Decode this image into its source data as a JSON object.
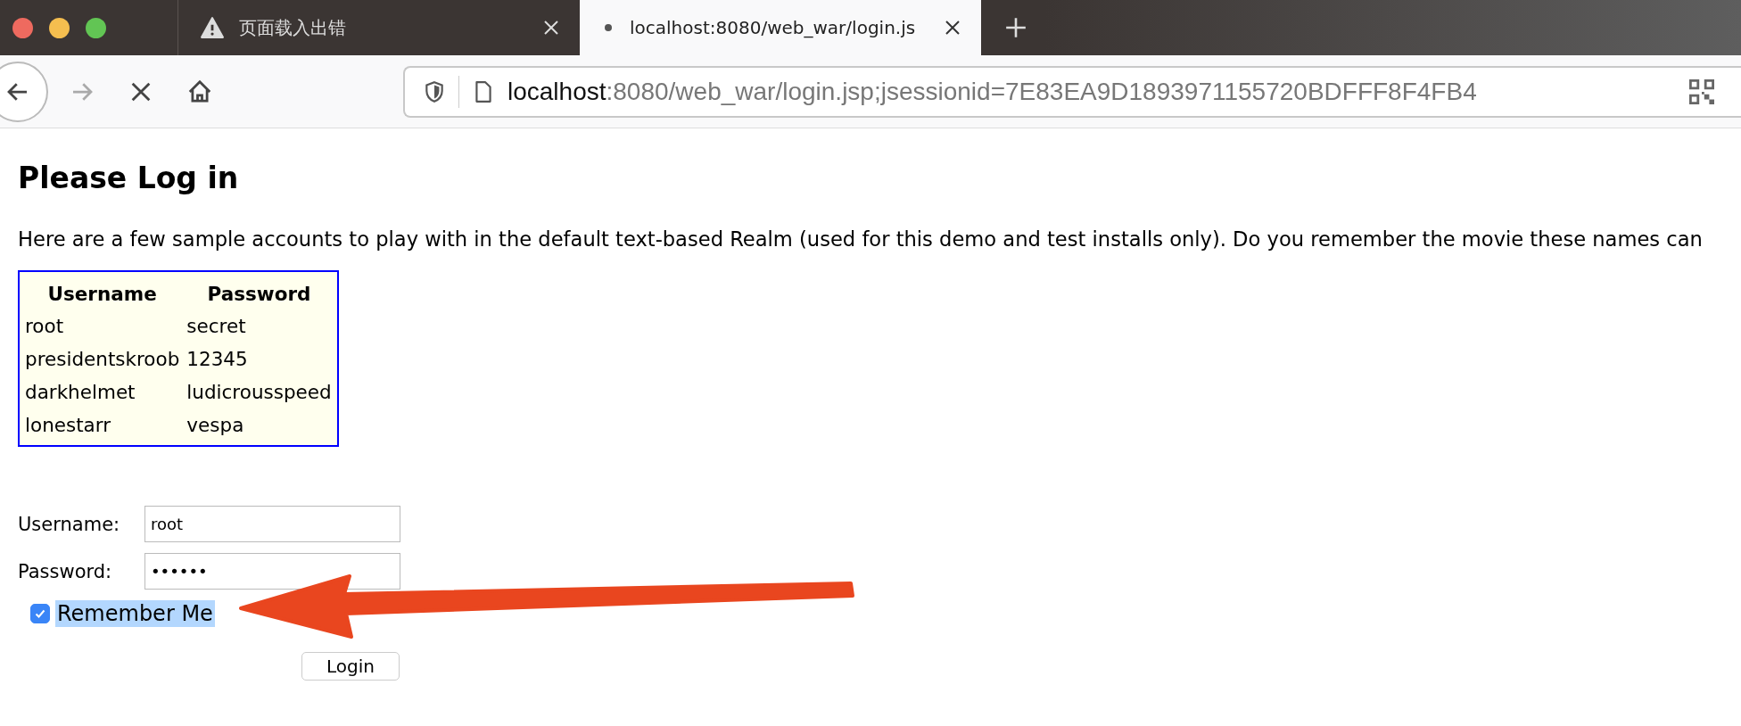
{
  "tabs": [
    {
      "title": "页面载入出错",
      "kind": "error",
      "selected": false
    },
    {
      "title": "localhost:8080/web_war/login.js",
      "kind": "loading",
      "selected": true
    }
  ],
  "address_bar": {
    "host": "localhost",
    "rest": ":8080/web_war/login.jsp;jsessionid=7E83EA9D1893971155720BDFFF8F4FB4"
  },
  "page": {
    "heading": "Please Log in",
    "intro": "Here are a few sample accounts to play with in the default text-based Realm (used for this demo and test installs only). Do you remember the movie these names can",
    "table": {
      "columns": [
        "Username",
        "Password"
      ],
      "rows": [
        [
          "root",
          "secret"
        ],
        [
          "presidentskroob",
          "12345"
        ],
        [
          "darkhelmet",
          "ludicrousspeed"
        ],
        [
          "lonestarr",
          "vespa"
        ]
      ]
    },
    "form": {
      "username_label": "Username:",
      "username_value": "root",
      "password_label": "Password:",
      "password_value": "••••••",
      "remember": {
        "label": "Remember Me",
        "checked": true,
        "selected": true
      },
      "submit": "Login"
    }
  }
}
